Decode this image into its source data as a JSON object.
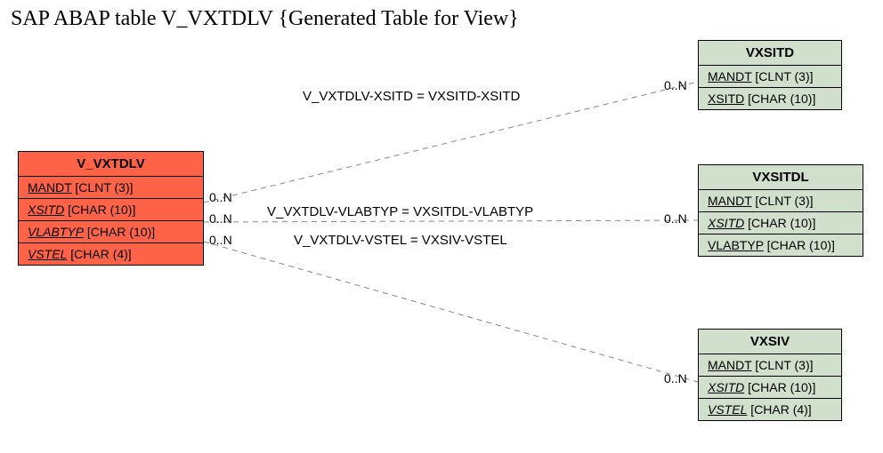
{
  "title": "SAP ABAP table V_VXTDLV {Generated Table for View}",
  "entities": {
    "main": {
      "name": "V_VXTDLV",
      "fields": [
        {
          "name": "MANDT",
          "type": "[CLNT (3)]",
          "style": "u"
        },
        {
          "name": "XSITD",
          "type": "[CHAR (10)]",
          "style": "ui"
        },
        {
          "name": "VLABTYP",
          "type": "[CHAR (10)]",
          "style": "ui"
        },
        {
          "name": "VSTEL",
          "type": "[CHAR (4)]",
          "style": "ui"
        }
      ]
    },
    "vxsitd": {
      "name": "VXSITD",
      "fields": [
        {
          "name": "MANDT",
          "type": "[CLNT (3)]",
          "style": "u"
        },
        {
          "name": "XSITD",
          "type": "[CHAR (10)]",
          "style": "u"
        }
      ]
    },
    "vxsitdl": {
      "name": "VXSITDL",
      "fields": [
        {
          "name": "MANDT",
          "type": "[CLNT (3)]",
          "style": "u"
        },
        {
          "name": "XSITD",
          "type": "[CHAR (10)]",
          "style": "ui"
        },
        {
          "name": "VLABTYP",
          "type": "[CHAR (10)]",
          "style": "u"
        }
      ]
    },
    "vxsiv": {
      "name": "VXSIV",
      "fields": [
        {
          "name": "MANDT",
          "type": "[CLNT (3)]",
          "style": "u"
        },
        {
          "name": "XSITD",
          "type": "[CHAR (10)]",
          "style": "ui"
        },
        {
          "name": "VSTEL",
          "type": "[CHAR (4)]",
          "style": "ui"
        }
      ]
    }
  },
  "relations": [
    {
      "label": "V_VXTDLV-XSITD = VXSITD-XSITD",
      "left_card": "0..N",
      "right_card": "0..N"
    },
    {
      "label": "V_VXTDLV-VLABTYP = VXSITDL-VLABTYP",
      "left_card": "0..N",
      "right_card": "0..N"
    },
    {
      "label": "V_VXTDLV-VSTEL = VXSIV-VSTEL",
      "left_card": "0..N",
      "right_card": "0..N"
    }
  ]
}
